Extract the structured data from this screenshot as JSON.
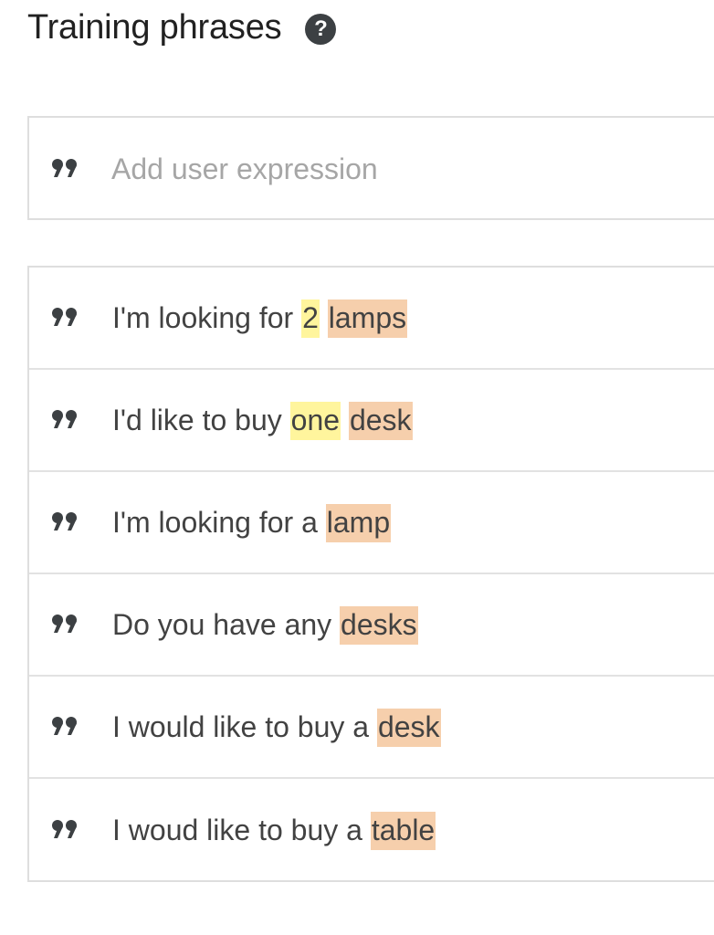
{
  "header": {
    "title": "Training phrases",
    "help_icon": "question-mark-circle"
  },
  "add_expression": {
    "icon": "quote-icon",
    "placeholder": "Add user expression",
    "value": ""
  },
  "phrases": [
    {
      "parts": [
        {
          "text": "I'm looking for ",
          "type": "plain"
        },
        {
          "text": "2",
          "type": "number"
        },
        {
          "text": " ",
          "type": "plain"
        },
        {
          "text": "lamps",
          "type": "product"
        }
      ]
    },
    {
      "parts": [
        {
          "text": "I'd like to buy ",
          "type": "plain"
        },
        {
          "text": "one",
          "type": "number"
        },
        {
          "text": " ",
          "type": "plain"
        },
        {
          "text": "desk",
          "type": "product"
        }
      ]
    },
    {
      "parts": [
        {
          "text": "I'm looking for a ",
          "type": "plain"
        },
        {
          "text": "lamp",
          "type": "product"
        }
      ]
    },
    {
      "parts": [
        {
          "text": "Do you have any ",
          "type": "plain"
        },
        {
          "text": "desks",
          "type": "product"
        }
      ]
    },
    {
      "parts": [
        {
          "text": "I would like to buy a ",
          "type": "plain"
        },
        {
          "text": "desk",
          "type": "product"
        }
      ]
    },
    {
      "parts": [
        {
          "text": "I woud like to buy a ",
          "type": "plain"
        },
        {
          "text": "table",
          "type": "product"
        }
      ]
    }
  ],
  "colors": {
    "number_highlight": "#fff59d",
    "product_highlight": "#f6cfac",
    "quote_icon": "#3c4043"
  }
}
